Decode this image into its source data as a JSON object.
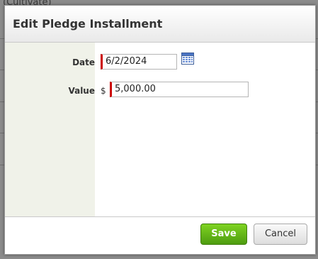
{
  "background": {
    "header_text": "(Cultivate)"
  },
  "dialog": {
    "title": "Edit Pledge Installment",
    "fields": {
      "date": {
        "label": "Date",
        "value": "6/2/2024"
      },
      "value": {
        "label": "Value",
        "currency_symbol": "$",
        "value": "5,000.00"
      }
    },
    "buttons": {
      "save": "Save",
      "cancel": "Cancel"
    }
  },
  "colors": {
    "required_marker": "#cc0000",
    "save_button": "#5fae17",
    "label_column": "#f0f2e9"
  },
  "icons": {
    "date_picker": "calendar-icon"
  }
}
